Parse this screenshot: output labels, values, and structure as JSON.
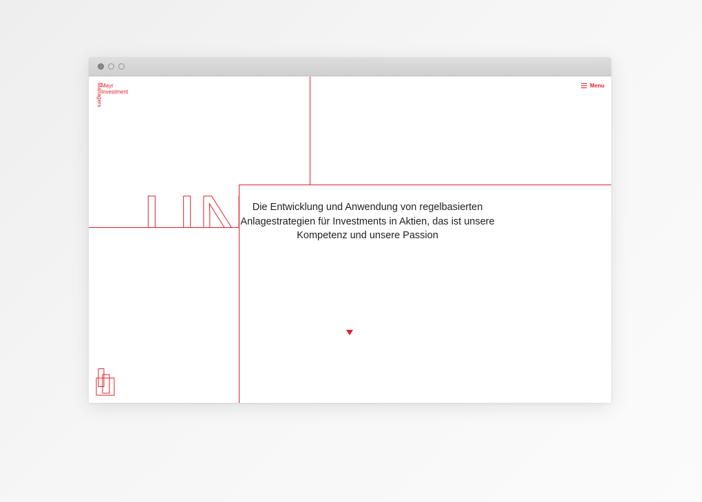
{
  "logo": {
    "line1": "Mayr",
    "line2": "Investment",
    "vertical": "Managers"
  },
  "menu": {
    "label": "Menu",
    "icon": "hamburger-icon"
  },
  "hero": {
    "outline_word": "UNT",
    "tagline_lines": [
      "Die Entwicklung und Anwendung von regelbasierten",
      "Anlagestrategien für Investments in Aktien, das ist unsere",
      "Kompetenz und unsere Passion"
    ],
    "scroll_icon": "triangle-down-icon"
  },
  "colors": {
    "accent": "#e3202a",
    "text": "#1e1e1e",
    "background": "#ffffff"
  }
}
